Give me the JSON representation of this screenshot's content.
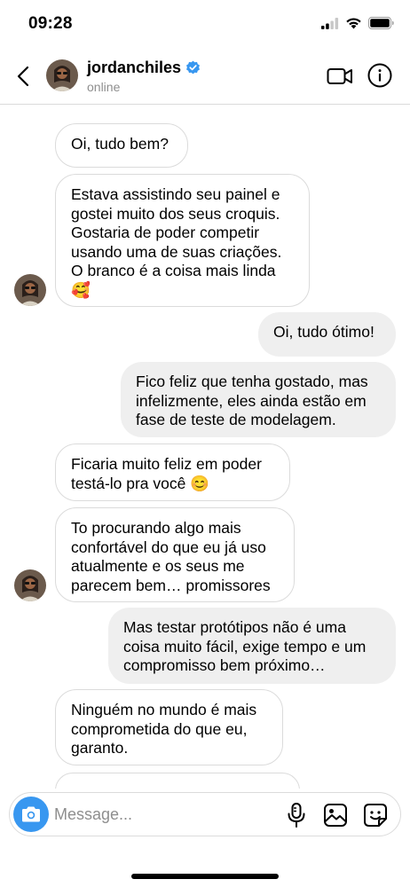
{
  "status_bar": {
    "time": "09:28"
  },
  "header": {
    "username": "jordanchiles",
    "status": "online",
    "verified": true
  },
  "messages": [
    {
      "from": "them",
      "text": "Oi, tudo bem?"
    },
    {
      "from": "them",
      "text": "Estava assistindo seu painel e gostei muito dos seus croquis. Gostaria de poder competir usando uma de suas criações. O branco é a coisa mais linda 🥰"
    },
    {
      "from": "me",
      "text": "Oi, tudo ótimo!"
    },
    {
      "from": "me",
      "text": "Fico feliz que tenha gostado, mas infelizmente, eles ainda estão em fase de teste de modelagem."
    },
    {
      "from": "them",
      "text": "Ficaria muito feliz em poder testá-lo pra você 😊"
    },
    {
      "from": "them",
      "text": "To procurando algo mais confortável do que eu já uso atualmente e os seus me parecem bem… promissores"
    },
    {
      "from": "me",
      "text": "Mas testar protótipos não é uma coisa muito fácil, exige tempo e um compromisso bem próximo…"
    },
    {
      "from": "them",
      "text": "Ninguém no mundo é mais comprometida do que eu, garanto."
    }
  ],
  "composer": {
    "placeholder": "Message..."
  },
  "colors": {
    "accent": "#3897f0",
    "verified": "#3897f0",
    "outgoing_bubble": "#efefef",
    "incoming_border": "#dbdbdb",
    "muted_text": "#8e8e8e"
  },
  "icons": [
    "back-chevron",
    "verified-badge",
    "video-camera",
    "info",
    "camera",
    "microphone",
    "gallery",
    "sticker"
  ]
}
